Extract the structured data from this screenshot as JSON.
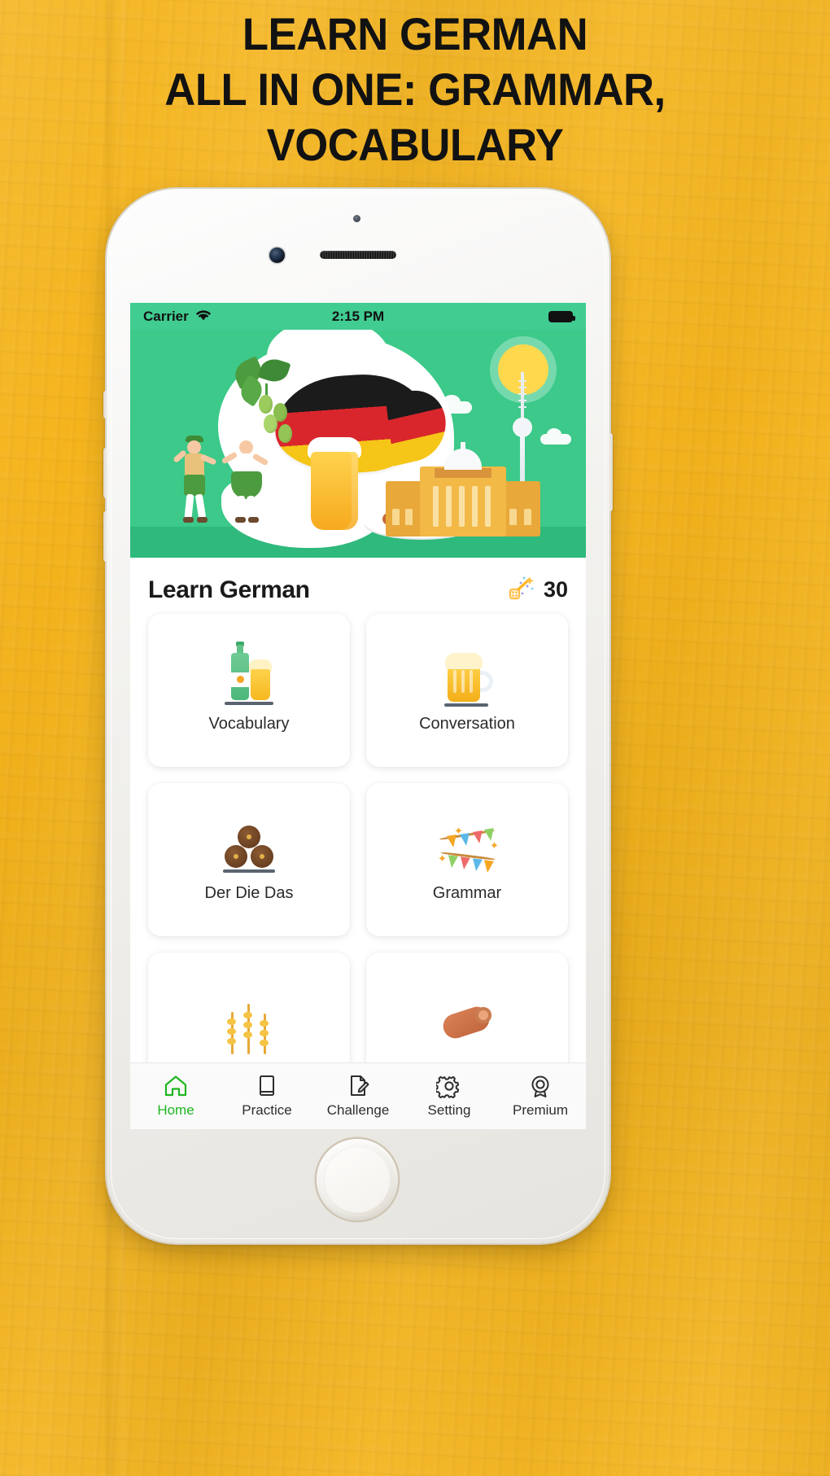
{
  "headline": {
    "lines": [
      "LEARN GERMAN",
      "ALL IN ONE: GRAMMAR,",
      "VOCABULARY"
    ]
  },
  "colors": {
    "background": "#F5B41C",
    "status_bar": "#41CC92",
    "hero": "#3CC98A",
    "active_tab": "#20B521",
    "card_background": "#FFFFFF",
    "title_text": "#1A1A1A"
  },
  "phone": {
    "status_bar": {
      "carrier": "Carrier",
      "wifi_icon": "wifi-icon",
      "time": "2:15 PM",
      "battery_icon": "battery-full-icon"
    },
    "hero": {
      "name": "germany-illustration-banner",
      "elements": [
        "german-flag",
        "hops",
        "dancers",
        "beer-glass",
        "sausage-plate",
        "reichstag-building",
        "tv-tower",
        "sun"
      ]
    },
    "header": {
      "title": "Learn German",
      "score_icon": "magic-wand-icon",
      "score_value": "30"
    },
    "cards": [
      {
        "label": "Vocabulary",
        "icon": "beer-bottle-and-glass-icon"
      },
      {
        "label": "Conversation",
        "icon": "beer-mug-icon"
      },
      {
        "label": "Der Die Das",
        "icon": "beer-barrels-icon"
      },
      {
        "label": "Grammar",
        "icon": "bunting-flags-icon"
      },
      {
        "label": "",
        "icon": "wheat-icon"
      },
      {
        "label": "",
        "icon": "sausage-icon"
      }
    ],
    "tabs": [
      {
        "label": "Home",
        "icon": "home-icon",
        "active": true
      },
      {
        "label": "Practice",
        "icon": "book-icon",
        "active": false
      },
      {
        "label": "Challenge",
        "icon": "edit-page-icon",
        "active": false
      },
      {
        "label": "Setting",
        "icon": "gear-icon",
        "active": false
      },
      {
        "label": "Premium",
        "icon": "badge-icon",
        "active": false
      }
    ]
  }
}
